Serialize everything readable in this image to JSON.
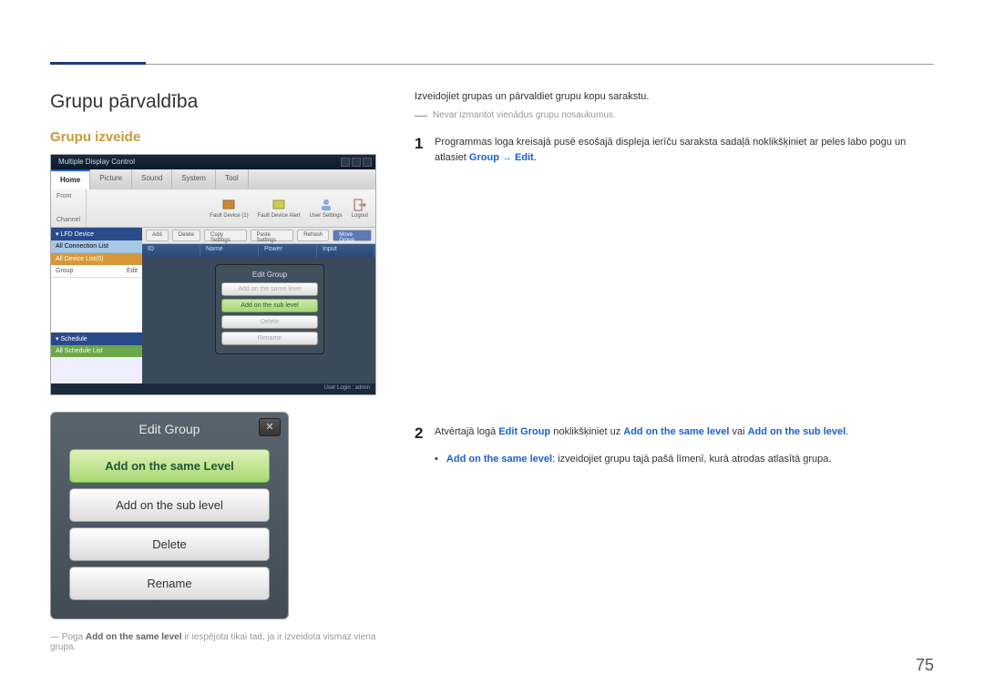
{
  "page_number": "75",
  "heading": "Grupu pārvaldība",
  "subheading": "Grupu izveide",
  "intro": "Izveidojiet grupas un pārvaldiet grupu kopu sarakstu.",
  "note": "Nevar izmantot vienādus grupu nosaukumus.",
  "step1": {
    "num": "1",
    "pre": "Programmas loga kreisajā pusē esošajā displeja ierīču saraksta sadaļā noklikšķiniet ar peles labo pogu un atlasiet ",
    "link1": "Group",
    "arrow_link": " → Edit",
    "post": "."
  },
  "step2": {
    "num": "2",
    "pre": "Atvērtajā logā ",
    "b1": "Edit Group",
    "mid1": " noklikšķiniet uz ",
    "b2": "Add on the same level",
    "mid2": " vai ",
    "b3": "Add on the sub level",
    "post": "."
  },
  "bullet": {
    "label": "Add on the same level",
    "tail": ": izveidojiet grupu tajā pašā līmenī, kurā atrodas atlasītā grupa."
  },
  "footnote": {
    "pre": "Poga ",
    "bold": "Add on the same level",
    "post": " ir iespējota tikai tad, ja ir izveidota vismaz viena grupa."
  },
  "ss1": {
    "title": "Multiple Display Control",
    "tabs": [
      "Home",
      "Picture",
      "Sound",
      "System",
      "Tool"
    ],
    "toolbar_left": [
      "Front",
      "Channel"
    ],
    "toolbar_icons": [
      "Fault Device (1)",
      "Fault Device Alert",
      "User Settings",
      "Logout"
    ],
    "sidebar": {
      "hdr1": "▾ LFD Device",
      "item1": "All Connection List",
      "sel": "All Device List(0)",
      "row_l": "Group",
      "row_r": "Edit",
      "hdr2": "▾ Schedule",
      "item2": "All Schedule List"
    },
    "btnrow": [
      "Add",
      "Delete",
      "Copy Settings",
      "Paste Settings",
      "Refresh",
      "Move Group"
    ],
    "cols": [
      "ID",
      "Name",
      "Power",
      "Input"
    ],
    "popup": {
      "title": "Edit Group",
      "btns": [
        "Add on the same level",
        "Add on the sub level",
        "Delete",
        "Rename"
      ]
    },
    "status": "User Login : admin"
  },
  "ss2": {
    "title": "Edit Group",
    "close": "✕",
    "btns": [
      "Add on the same Level",
      "Add on the sub level",
      "Delete",
      "Rename"
    ]
  }
}
